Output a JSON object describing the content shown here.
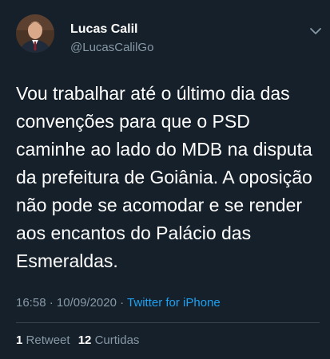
{
  "author": {
    "display_name": "Lucas Calil",
    "handle": "@LucasCalilGo",
    "avatar_icon": "profile-photo"
  },
  "tweet": {
    "text": "Vou trabalhar até o último dia das\nconvenções para que o PSD\ncaminhe ao lado do MDB na disputa\nda prefeitura de Goiânia. A oposição\nnão pode se acomodar e se render\naos encantos do Palácio das\nEsmeraldas.",
    "time": "16:58",
    "date": "10/09/2020",
    "separator": "·",
    "source": "Twitter for iPhone"
  },
  "stats": {
    "retweets_count": "1",
    "retweets_label": "Retweet",
    "likes_count": "12",
    "likes_label": "Curtidas"
  },
  "colors": {
    "background": "#15202b",
    "secondary_text": "#8899a6",
    "link": "#1da1f2",
    "divider": "#38444d"
  }
}
